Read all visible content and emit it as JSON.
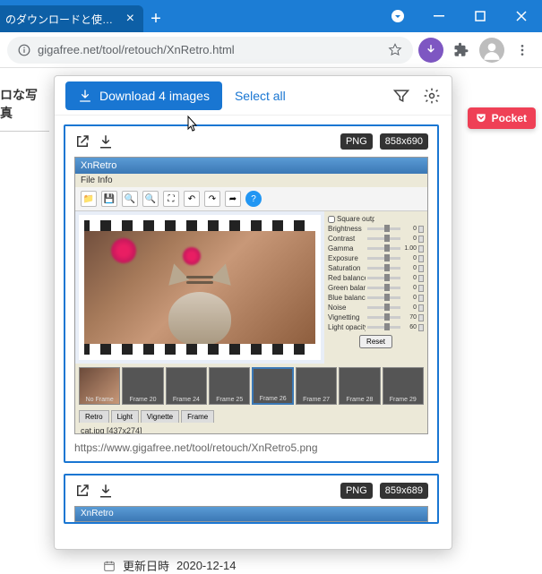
{
  "browser": {
    "tab_title": "のダウンロードと使い方 - k",
    "url": "gigafree.net/tool/retouch/XnRetro.html"
  },
  "page": {
    "sidebar_heading": "ロな写真",
    "update_label": "更新日時",
    "update_date": "2020-12-14"
  },
  "popup": {
    "download_label": "Download 4 images",
    "select_all": "Select all",
    "cards": [
      {
        "format": "PNG",
        "dimensions": "858x690",
        "url": "https://www.gigafree.net/tool/retouch/XnRetro5.png",
        "app_title": "XnRetro",
        "menu": "File   Info",
        "status": "cat.jpg  [437x274]",
        "sliders": [
          {
            "label": "Brightness",
            "val": "0"
          },
          {
            "label": "Contrast",
            "val": "0"
          },
          {
            "label": "Gamma",
            "val": "1.00"
          },
          {
            "label": "Exposure",
            "val": "0"
          },
          {
            "label": "Saturation",
            "val": "0"
          },
          {
            "label": "Red balance",
            "val": "0"
          },
          {
            "label": "Green balance",
            "val": "0"
          },
          {
            "label": "Blue balance",
            "val": "0"
          },
          {
            "label": "Noise",
            "val": "0"
          },
          {
            "label": "Vignetting",
            "val": "70"
          },
          {
            "label": "Light opacity",
            "val": "60"
          }
        ],
        "square_output": "Square output",
        "reset": "Reset",
        "frames": [
          "No Frame",
          "Frame 20",
          "Frame 24",
          "Frame 25",
          "Frame 26",
          "Frame 27",
          "Frame 28",
          "Frame 29"
        ],
        "tabs": [
          "Retro",
          "Light",
          "Vignette",
          "Frame"
        ]
      },
      {
        "format": "PNG",
        "dimensions": "859x689",
        "app_title": "XnRetro"
      }
    ]
  },
  "pocket": {
    "label": "Pocket"
  }
}
